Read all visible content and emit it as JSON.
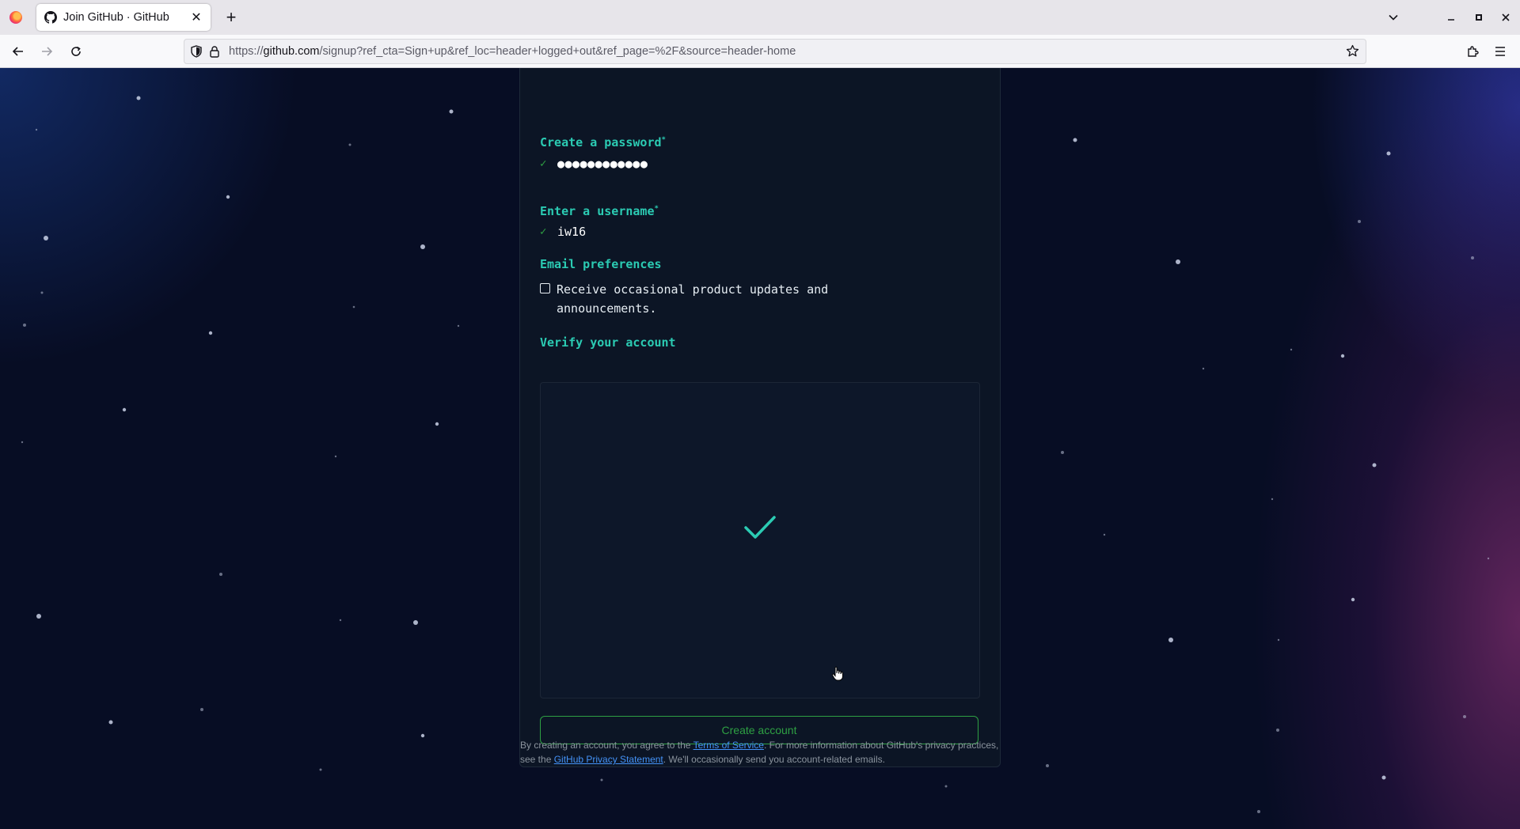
{
  "browser": {
    "tab": {
      "title": "Join GitHub · GitHub"
    },
    "url": {
      "scheme": "https://",
      "host": "github.com",
      "path": "/signup?ref_cta=Sign+up&ref_loc=header+logged+out&ref_page=%2F&source=header-home"
    }
  },
  "form": {
    "password": {
      "label": "Create a password",
      "required_mark": "*",
      "value": "●●●●●●●●●●●●",
      "valid_mark": "✓"
    },
    "username": {
      "label": "Enter a username",
      "required_mark": "*",
      "value": "iw16",
      "valid_mark": "✓"
    },
    "email_prefs": {
      "label": "Email preferences",
      "checkbox_label": "Receive occasional product updates and announcements.",
      "checked": false
    },
    "verify": {
      "label": "Verify your account",
      "status_icon": "checkmark-icon"
    },
    "submit_label": "Create account"
  },
  "legal": {
    "text_1": "By creating an account, you agree to the ",
    "tos_link": "Terms of Service",
    "text_2": ". For more information about GitHub's privacy practices, see the ",
    "privacy_link": "GitHub Privacy Statement",
    "text_3": ". We'll occasionally send you account-related emails."
  },
  "colors": {
    "accent_teal": "#2bcbb3",
    "success_green": "#2ea043",
    "link_blue": "#4493f8",
    "page_bg": "#070d24"
  }
}
